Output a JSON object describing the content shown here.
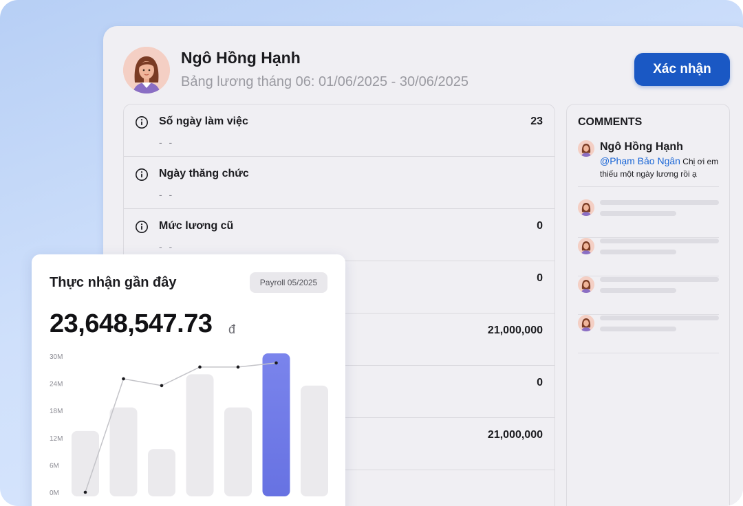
{
  "employee": {
    "name": "Ngô Hồng Hạnh",
    "period": "Bảng lương tháng 06: 01/06/2025 - 30/06/2025"
  },
  "actions": {
    "confirm_label": "Xác nhận"
  },
  "payroll_rows": [
    {
      "label": "Số ngày làm việc",
      "sub": "- -",
      "value": "23"
    },
    {
      "label": "Ngày thăng chức",
      "sub": "- -",
      "value": ""
    },
    {
      "label": "Mức lương cũ",
      "sub": "- -",
      "value": "0"
    },
    {
      "label": "",
      "sub": "",
      "value": "0"
    },
    {
      "label": "",
      "sub": "",
      "value": "21,000,000"
    },
    {
      "label": "",
      "sub": "",
      "value": "0"
    },
    {
      "label": "",
      "sub": "",
      "value": "21,000,000"
    }
  ],
  "comments": {
    "title": "COMMENTS",
    "items": [
      {
        "name": "Ngô Hồng Hạnh",
        "mention": "@Phạm Bảo Ngân",
        "text": "Chị ơi em thiếu một ngày lương rồi ạ"
      }
    ]
  },
  "recent_pay": {
    "title": "Thực nhận gần đây",
    "badge": "Payroll 05/2025",
    "amount": "23,648,547.73",
    "currency": "đ"
  },
  "colors": {
    "accent": "#1a58c4",
    "highlight_bar": "#6772e2",
    "bar": "#ebeaed",
    "line": "#c3c3c8"
  },
  "chart_data": {
    "type": "bar",
    "yticks": [
      "0M",
      "6M",
      "12M",
      "18M",
      "24M",
      "30M"
    ],
    "ylim": [
      0,
      30
    ],
    "bars": [
      13.5,
      18.7,
      9.5,
      26,
      18.7,
      31,
      23.5
    ],
    "line": [
      0,
      25,
      23.5,
      27.6,
      27.6,
      28.5
    ],
    "highlight_index": 5
  }
}
